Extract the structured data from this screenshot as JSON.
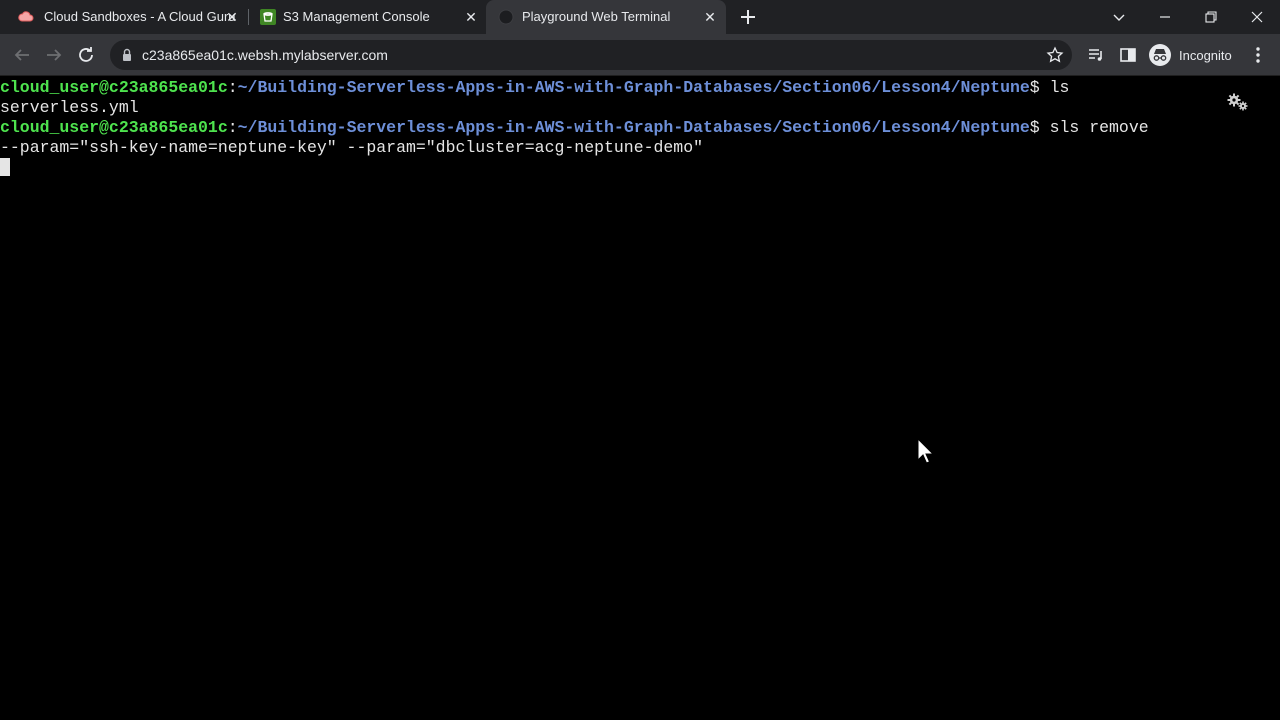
{
  "tabs": [
    {
      "title": "Cloud Sandboxes - A Cloud Guru",
      "icon": "cloud-icon",
      "active": false
    },
    {
      "title": "S3 Management Console",
      "icon": "aws-s3-icon",
      "active": false
    },
    {
      "title": "Playground Web Terminal",
      "icon": "globe-icon",
      "active": true
    }
  ],
  "toolbar": {
    "url": "c23a865ea01c.websh.mylabserver.com",
    "profile_label": "Incognito"
  },
  "terminal": {
    "line1": {
      "user": "cloud_user@c23a865ea01c",
      "sep": ":",
      "path": "~/Building-Serverless-Apps-in-AWS-with-Graph-Databases/Section06/Lesson4/Neptune",
      "suffix": "$ ls"
    },
    "line2": "serverless.yml",
    "line3": {
      "user": "cloud_user@c23a865ea01c",
      "sep": ":",
      "path": "~/Building-Serverless-Apps-in-AWS-with-Graph-Databases/Section06/Lesson4/Neptune",
      "suffix": "$ sls remove"
    },
    "line4": "--param=\"ssh-key-name=neptune-key\" --param=\"dbcluster=acg-neptune-demo\""
  },
  "colors": {
    "prompt_user": "#4ee34e",
    "prompt_path": "#6d8fd8",
    "terminal_bg": "#000000",
    "tab_strip_bg": "#202124",
    "toolbar_bg": "#35363a"
  }
}
